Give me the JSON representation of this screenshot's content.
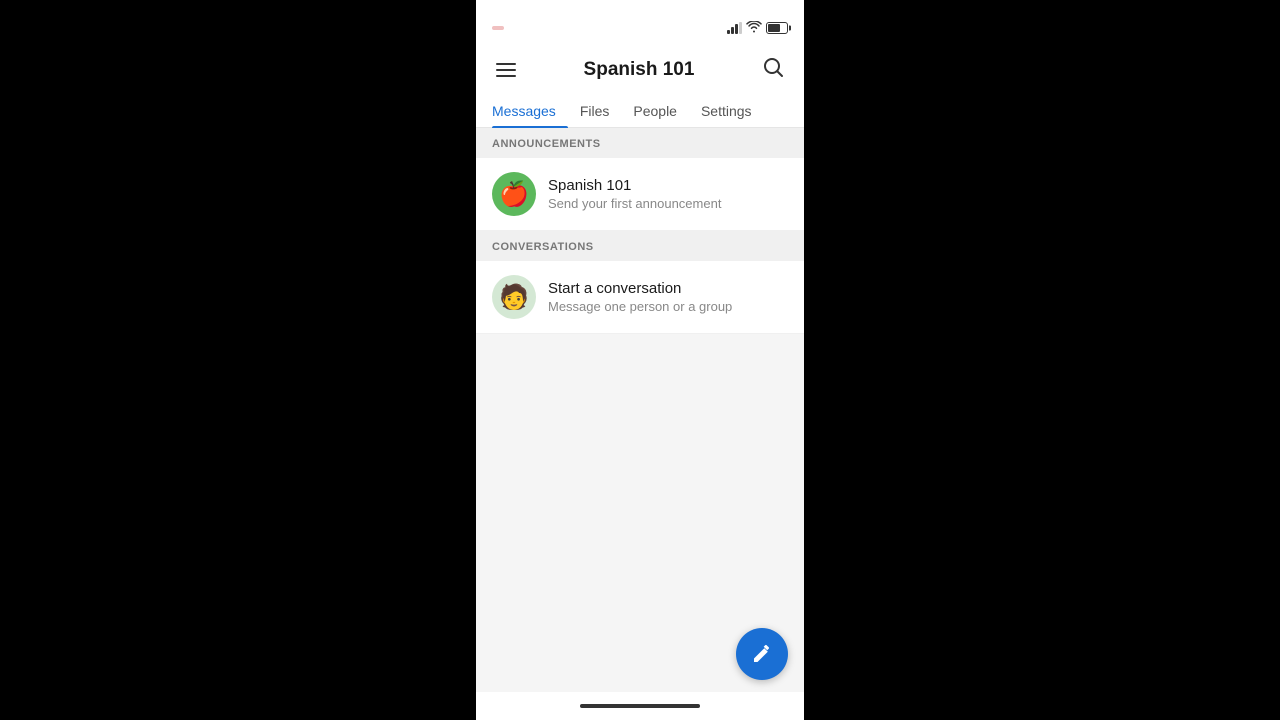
{
  "status_bar": {
    "time": "",
    "time_display": "●●●●"
  },
  "header": {
    "title": "Spanish 101",
    "hamburger_label": "Menu",
    "search_label": "Search"
  },
  "tabs": [
    {
      "id": "messages",
      "label": "Messages",
      "active": true
    },
    {
      "id": "files",
      "label": "Files",
      "active": false
    },
    {
      "id": "people",
      "label": "People",
      "active": false
    },
    {
      "id": "settings",
      "label": "Settings",
      "active": false
    }
  ],
  "sections": {
    "announcements": {
      "header": "ANNOUNCEMENTS",
      "item": {
        "title": "Spanish 101",
        "subtitle": "Send your first announcement",
        "emoji": "🍎"
      }
    },
    "conversations": {
      "header": "CONVERSATIONS",
      "item": {
        "title": "Start a conversation",
        "subtitle": "Message one person or a group",
        "emoji": "🧑"
      }
    }
  },
  "fab": {
    "label": "Compose",
    "icon": "✏️"
  }
}
